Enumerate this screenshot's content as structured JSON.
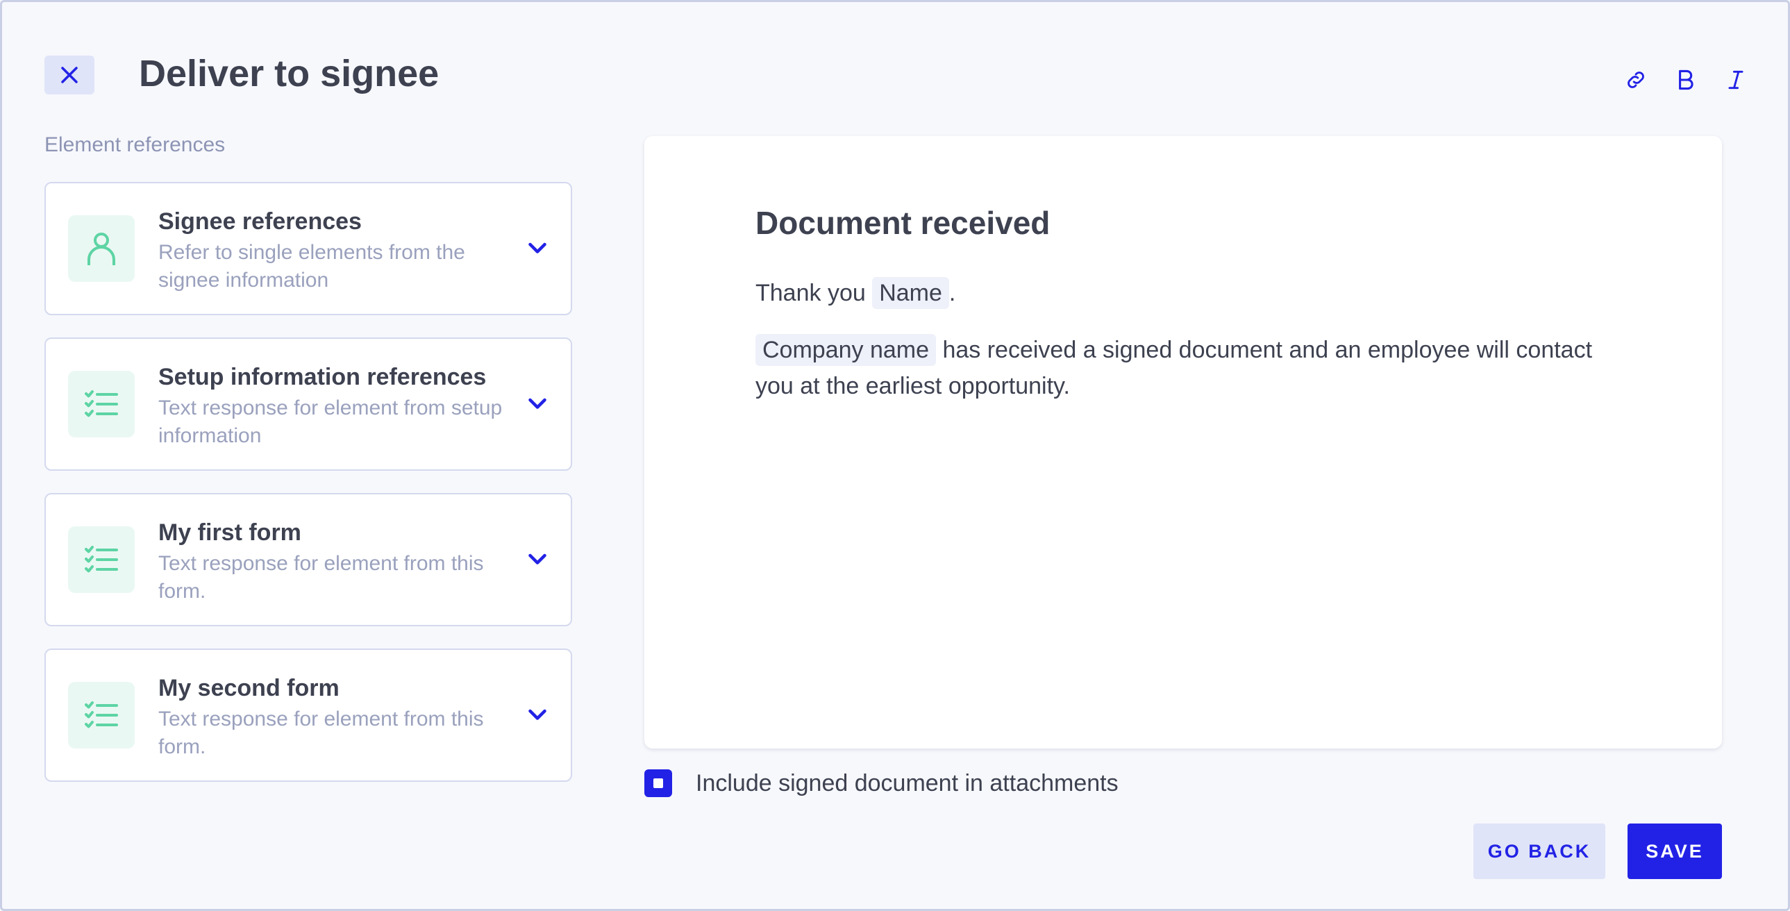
{
  "dialog": {
    "title": "Deliver to signee"
  },
  "toolbar": {
    "link_icon": "link-icon",
    "bold_icon": "bold-icon",
    "italic_icon": "italic-icon"
  },
  "references": {
    "section_label": "Element references",
    "items": [
      {
        "title": "Signee references",
        "description": "Refer to single elements from the signee information",
        "icon": "user-icon"
      },
      {
        "title": "Setup information references",
        "description": "Text response for element from setup information",
        "icon": "checklist-icon"
      },
      {
        "title": "My first form",
        "description": "Text response for element from this form.",
        "icon": "checklist-icon"
      },
      {
        "title": "My second form",
        "description": "Text response for element from this form.",
        "icon": "checklist-icon"
      }
    ]
  },
  "editor": {
    "heading": "Document received",
    "line1_prefix": "Thank you",
    "line1_chip": "Name",
    "line1_suffix": ".",
    "line2_chip": "Company name",
    "line2_text": "has received a signed document and an employee will contact you at the earliest opportunity."
  },
  "attachment": {
    "label": "Include signed document in attachments",
    "checked": true
  },
  "actions": {
    "back_label": "GO BACK",
    "save_label": "SAVE"
  },
  "colors": {
    "accent": "#2222e6",
    "icon_green": "#5dd4a4",
    "muted_text": "#9aa1bd"
  }
}
